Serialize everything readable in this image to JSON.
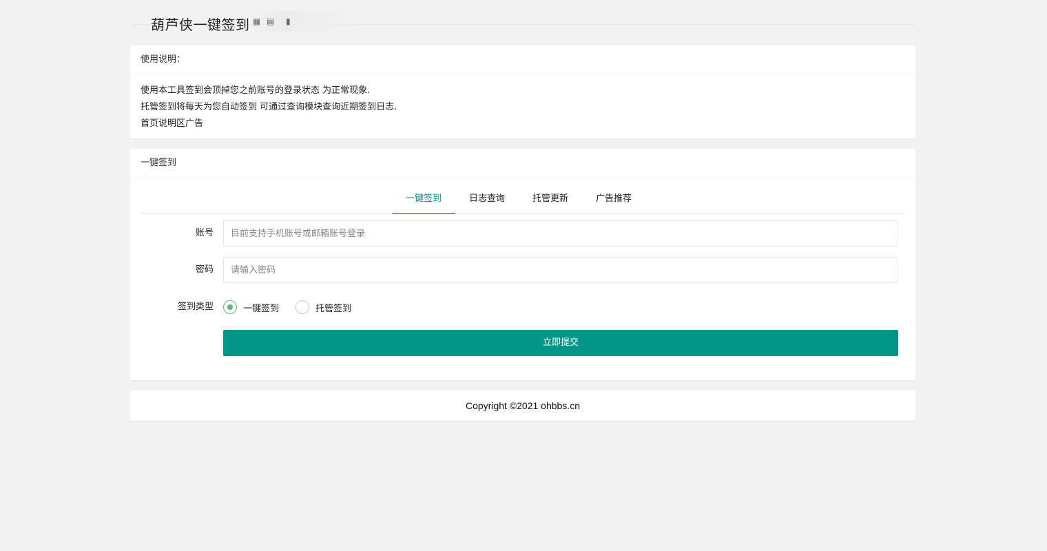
{
  "header": {
    "title": "葫芦侠一键签到"
  },
  "instructions": {
    "heading": "使用说明：",
    "lines": [
      "使用本工具签到会顶掉您之前账号的登录状态 为正常现象.",
      "托管签到将每天为您自动签到 可通过查询模块查询近期签到日志.",
      "首页说明区广告"
    ]
  },
  "signin": {
    "heading": "一键签到",
    "tabs": [
      "一键签到",
      "日志查询",
      "托管更新",
      "广告推荐"
    ],
    "active_tab": "一键签到",
    "account": {
      "label": "账号",
      "placeholder": "目前支持手机账号或邮箱账号登录",
      "value": ""
    },
    "password": {
      "label": "密码",
      "placeholder": "请输入密码",
      "value": ""
    },
    "type": {
      "label": "签到类型",
      "options": [
        "一键签到",
        "托管签到"
      ],
      "selected": "一键签到"
    },
    "submit_label": "立即提交"
  },
  "footer": {
    "copyright": "Copyright ©2021 ohbbs.cn"
  },
  "colors": {
    "accent": "#009688",
    "radio_checked": "#5fb878",
    "background": "#f2f2f2"
  }
}
